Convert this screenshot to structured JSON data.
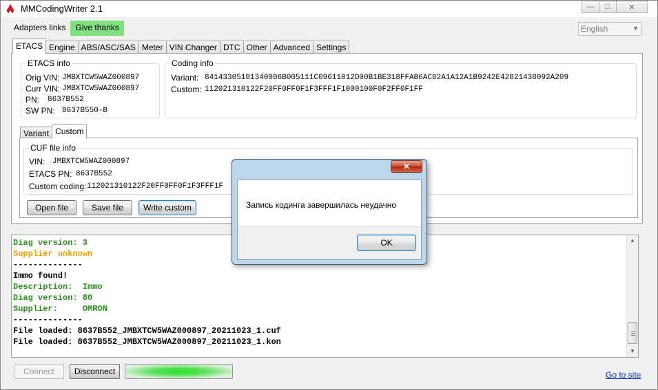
{
  "window": {
    "title": "MMCodingWriter 2.1"
  },
  "menu": {
    "adapters": "Adapters links",
    "thanks": "Give thanks"
  },
  "language": {
    "selected": "English"
  },
  "tabs": [
    "ETACS",
    "Engine",
    "ABS/ASC/SAS",
    "Meter",
    "VIN Changer",
    "DTC",
    "Other",
    "Advanced",
    "Settings"
  ],
  "etacs_info": {
    "title": "ETACS info",
    "orig_vin_label": "Orig VIN:",
    "orig_vin": "JMBXTCW5WAZ000897",
    "curr_vin_label": "Curr VIN:",
    "curr_vin": "JMBXTCW5WAZ000897",
    "pn_label": "PN:",
    "pn": "8637B552",
    "sw_pn_label": "SW PN:",
    "sw_pn": "8637B550-B"
  },
  "coding_info": {
    "title": "Coding info",
    "variant_label": "Variant:",
    "variant": "84143305181340086B005111C09611012D00B1BE318FFAB6AC82A1A12A1B9242E42821438092A209",
    "custom_label": "Custom:",
    "custom": "112021310122F20FF0FF0F1F3FFF1F1000100F0F2FF0F1FF"
  },
  "subtabs": [
    "Variant",
    "Custom"
  ],
  "cuf_info": {
    "title": "CUF file info",
    "vin_label": "VIN:",
    "vin": "JMBXTCW5WAZ000897",
    "etacs_pn_label": "ETACS PN:",
    "etacs_pn": "8637B552",
    "custom_coding_label": "Custom coding:",
    "custom_coding": "112021310122F20FF0FF0F1F3FFF1F"
  },
  "buttons": {
    "open": "Open file",
    "save": "Save file",
    "write": "Write custom",
    "connect": "Connect",
    "disconnect": "Disconnect"
  },
  "log": [
    {
      "text": "Diag version: 3",
      "color": "#2e8b1e"
    },
    {
      "text": "Supplier unknown",
      "color": "#e8a000"
    },
    {
      "text": "--------------",
      "color": "#000000"
    },
    {
      "text": "Immo found!",
      "color": "#000000"
    },
    {
      "text": "Description:  Immo",
      "color": "#2e8b1e"
    },
    {
      "text": "Diag version: 80",
      "color": "#2e8b1e"
    },
    {
      "text": "Supplier:     OMRON",
      "color": "#2e8b1e"
    },
    {
      "text": "--------------",
      "color": "#000000"
    },
    {
      "text": "File loaded: 8637B552_JMBXTCW5WAZ000897_20211023_1.cuf",
      "color": "#000000"
    },
    {
      "text": "File loaded: 8637B552_JMBXTCW5WAZ000897_20211023_1.kon",
      "color": "#000000"
    }
  ],
  "progress": {
    "fraction": 1.0
  },
  "footer": {
    "link": "Go to site"
  },
  "dialog": {
    "close": "✕",
    "message": "Запись кодинга завершилась неудачно",
    "ok": "OK"
  }
}
